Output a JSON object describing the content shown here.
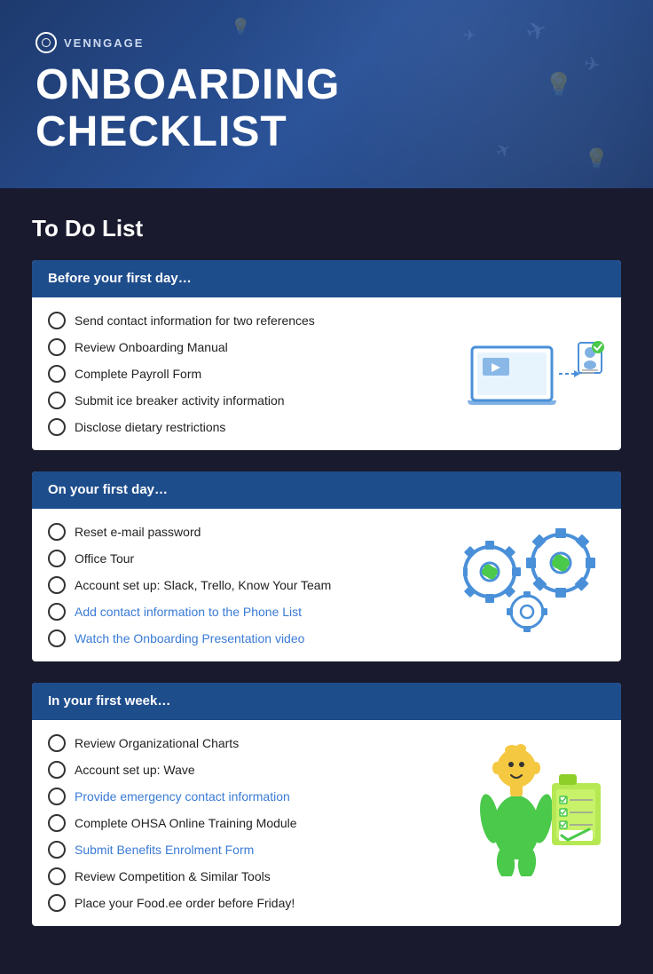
{
  "header": {
    "logo_text": "VENNGAGE",
    "title_line1": "ONBOARDING",
    "title_line2": "CHECKLIST"
  },
  "main": {
    "section_title": "To Do List",
    "cards": [
      {
        "id": "before-first-day",
        "header": "Before your first day…",
        "items": [
          {
            "id": "item-1",
            "text": "Send contact information for two references",
            "is_link": false
          },
          {
            "id": "item-2",
            "text": "Review Onboarding Manual",
            "is_link": false
          },
          {
            "id": "item-3",
            "text": "Complete Payroll Form",
            "is_link": false
          },
          {
            "id": "item-4",
            "text": "Submit ice breaker activity information",
            "is_link": false
          },
          {
            "id": "item-5",
            "text": "Disclose dietary restrictions",
            "is_link": false
          }
        ]
      },
      {
        "id": "first-day",
        "header": "On your first day…",
        "items": [
          {
            "id": "item-6",
            "text": "Reset e-mail password",
            "is_link": false
          },
          {
            "id": "item-7",
            "text": "Office Tour",
            "is_link": false
          },
          {
            "id": "item-8",
            "text": "Account set up: Slack, Trello, Know Your Team",
            "is_link": false
          },
          {
            "id": "item-9",
            "text": "Add contact information to the Phone List",
            "is_link": true
          },
          {
            "id": "item-10",
            "text": "Watch the Onboarding Presentation video",
            "is_link": true
          }
        ]
      },
      {
        "id": "first-week",
        "header": "In your first week…",
        "items": [
          {
            "id": "item-11",
            "text": "Review Organizational Charts",
            "is_link": false
          },
          {
            "id": "item-12",
            "text": "Account set up: Wave",
            "is_link": false
          },
          {
            "id": "item-13",
            "text": "Provide emergency contact information",
            "is_link": true
          },
          {
            "id": "item-14",
            "text": "Complete OHSA Online Training Module",
            "is_link": false
          },
          {
            "id": "item-15",
            "text": "Submit Benefits Enrolment Form",
            "is_link": true
          },
          {
            "id": "item-16",
            "text": "Review Competition & Similar Tools",
            "is_link": false
          },
          {
            "id": "item-17",
            "text": "Place your Food.ee order before Friday!",
            "is_link": false
          }
        ]
      }
    ]
  }
}
